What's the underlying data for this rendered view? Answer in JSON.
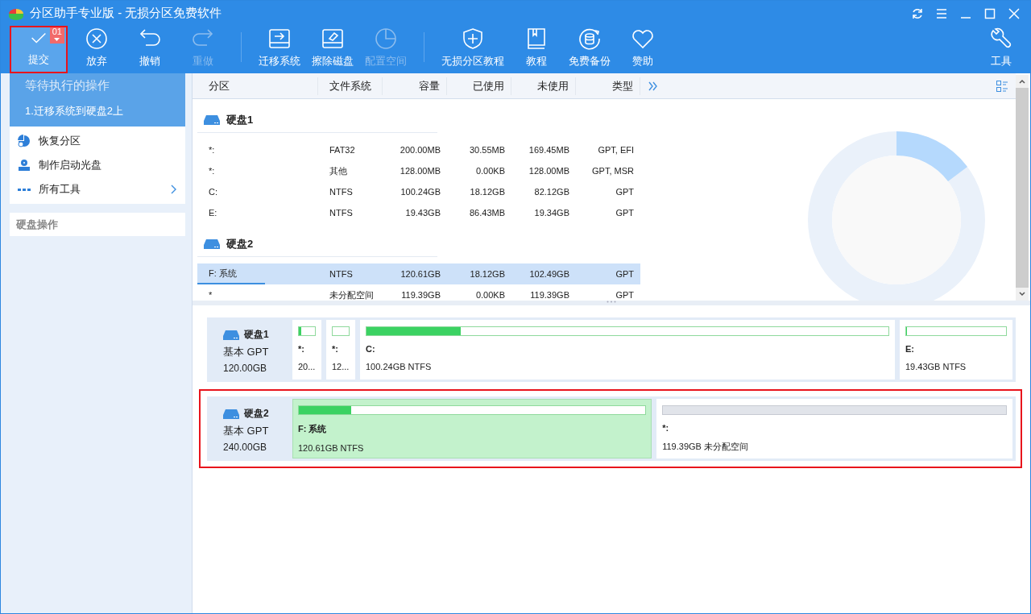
{
  "window": {
    "title": "分区助手专业版 - 无损分区免费软件"
  },
  "toolbar": {
    "items": [
      {
        "kind": "check",
        "label": "提交",
        "disabled": false,
        "highlighted": true,
        "badge": "01"
      },
      {
        "kind": "cancel",
        "label": "放弃",
        "disabled": false,
        "highlighted": false
      },
      {
        "kind": "undo",
        "label": "撤销",
        "disabled": false,
        "highlighted": false
      },
      {
        "kind": "redo",
        "label": "重做",
        "disabled": true,
        "highlighted": false
      },
      {
        "kind": "separator"
      },
      {
        "kind": "migrate",
        "label": "迁移系统",
        "disabled": false,
        "highlighted": false
      },
      {
        "kind": "wipe",
        "label": "擦除磁盘",
        "disabled": false,
        "highlighted": false
      },
      {
        "kind": "allocate",
        "label": "配置空间",
        "disabled": true,
        "highlighted": false
      },
      {
        "kind": "separator"
      },
      {
        "kind": "shield",
        "label": "无损分区教程",
        "disabled": false,
        "highlighted": false
      },
      {
        "kind": "book",
        "label": "教程",
        "disabled": false,
        "highlighted": false
      },
      {
        "kind": "backup",
        "label": "免费备份",
        "disabled": false,
        "highlighted": false
      },
      {
        "kind": "heart",
        "label": "赞助",
        "disabled": false,
        "highlighted": false
      }
    ],
    "right": {
      "kind": "wrench",
      "label": "工具"
    }
  },
  "sidebar": {
    "pending": {
      "title": "等待执行的操作",
      "items": [
        "1.迁移系统到硬盘2上"
      ]
    },
    "tools": [
      {
        "kind": "restore",
        "label": "恢复分区",
        "submenu": false
      },
      {
        "kind": "bootdisk",
        "label": "制作启动光盘",
        "submenu": false
      },
      {
        "kind": "more",
        "label": "所有工具",
        "submenu": true
      }
    ],
    "disk_ops": {
      "title": "硬盘操作"
    }
  },
  "table": {
    "columns": [
      "分区",
      "文件系统",
      "容量",
      "已使用",
      "未使用",
      "类型"
    ],
    "groups": [
      {
        "name": "硬盘1",
        "rows": [
          {
            "cells": [
              "*:",
              "FAT32",
              "200.00MB",
              "30.55MB",
              "169.45MB",
              "GPT, EFI"
            ],
            "selected": false
          },
          {
            "cells": [
              "*:",
              "其他",
              "128.00MB",
              "0.00KB",
              "128.00MB",
              "GPT, MSR"
            ],
            "selected": false
          },
          {
            "cells": [
              "C:",
              "NTFS",
              "100.24GB",
              "18.12GB",
              "82.12GB",
              "GPT"
            ],
            "selected": false
          },
          {
            "cells": [
              "E:",
              "NTFS",
              "19.43GB",
              "86.43MB",
              "19.34GB",
              "GPT"
            ],
            "selected": false
          }
        ]
      },
      {
        "name": "硬盘2",
        "rows": [
          {
            "cells": [
              "F: 系统",
              "NTFS",
              "120.61GB",
              "18.12GB",
              "102.49GB",
              "GPT"
            ],
            "selected": true
          },
          {
            "cells": [
              "*",
              "未分配空间",
              "119.39GB",
              "0.00KB",
              "119.39GB",
              "GPT"
            ],
            "selected": false
          }
        ]
      }
    ]
  },
  "disk_map": [
    {
      "name": "硬盘1",
      "type": "基本 GPT",
      "size": "120.00GB",
      "highlighted": false,
      "partitions": [
        {
          "kind": "used",
          "label": "*:",
          "detail": "20...",
          "level": 0.15,
          "selected": false
        },
        {
          "kind": "used",
          "label": "*:",
          "detail": "12...",
          "level": 0,
          "selected": false
        },
        {
          "kind": "used",
          "label": "C:",
          "detail": "100.24GB NTFS",
          "level": 0.18,
          "selected": false
        },
        {
          "kind": "used",
          "label": "E:",
          "detail": "19.43GB NTFS",
          "level": 0.005,
          "selected": false
        }
      ]
    },
    {
      "name": "硬盘2",
      "type": "基本 GPT",
      "size": "240.00GB",
      "highlighted": true,
      "partitions": [
        {
          "kind": "used",
          "label": "F: 系统",
          "detail": "120.61GB NTFS",
          "level": 0.15,
          "selected": true
        },
        {
          "kind": "unallocated",
          "label": "*:",
          "detail": "119.39GB 未分配空间",
          "selected": false
        }
      ]
    }
  ]
}
